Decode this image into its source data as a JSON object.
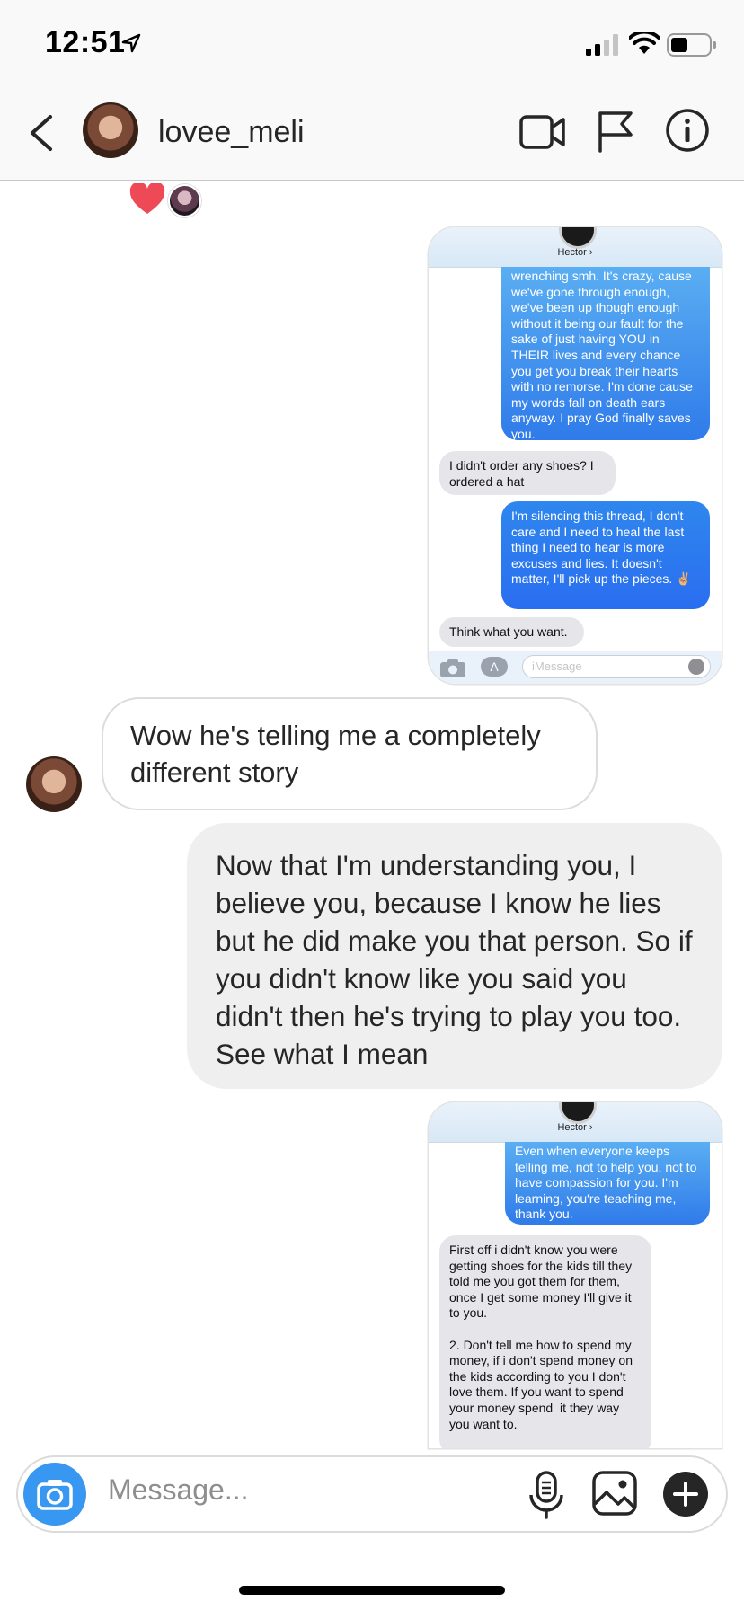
{
  "status_bar": {
    "time": "12:51"
  },
  "header": {
    "username": "lovee_meli"
  },
  "embedded_screenshot_1": {
    "contact_name": "Hector ›",
    "messages": [
      {
        "from": "me",
        "text": "wrenching smh. It's crazy, cause we've gone through enough, we've been up though enough without it being our fault for the sake of just having YOU in THEIR lives and every chance you get you break their hearts with no remorse. I'm done cause my words fall on death ears anyway. I pray God finally saves you."
      },
      {
        "from": "them",
        "text": "I didn't order any shoes? I ordered a hat"
      },
      {
        "from": "me",
        "text": "I'm silencing this thread, I don't care and I need to heal the last thing I need to hear is more excuses and lies. It doesn't matter, I'll pick up the pieces. ✌🏼"
      },
      {
        "from": "them",
        "text": "Think what you want."
      }
    ],
    "input_placeholder": "iMessage"
  },
  "incoming_message": "Wow he's telling me a completely different story",
  "outgoing_message": "Now that I'm understanding you, I believe you, because I know he lies but he did make you that person. So if you didn't know like you said you didn't then he's trying to play you too. See what I mean",
  "embedded_screenshot_2": {
    "contact_name": "Hector ›",
    "messages": [
      {
        "from": "me",
        "text": "Even when everyone keeps telling me, not to help you, not to have compassion for you. I'm learning, you're teaching me, thank you."
      },
      {
        "from": "them",
        "text": "First off i didn't know you were getting shoes for the kids till they told me you got them for them, once I get some money I'll give it to you.\n\n2. Don't tell me how to spend my money, if i don't spend money on the kids according to you I don't love them. If you want to spend your money spend  it they way you want to."
      }
    ]
  },
  "composer": {
    "placeholder": "Message..."
  },
  "colors": {
    "ig_blue": "#3897f0",
    "imessage_blue": "#2f7bea",
    "heart": "#ed4956"
  }
}
